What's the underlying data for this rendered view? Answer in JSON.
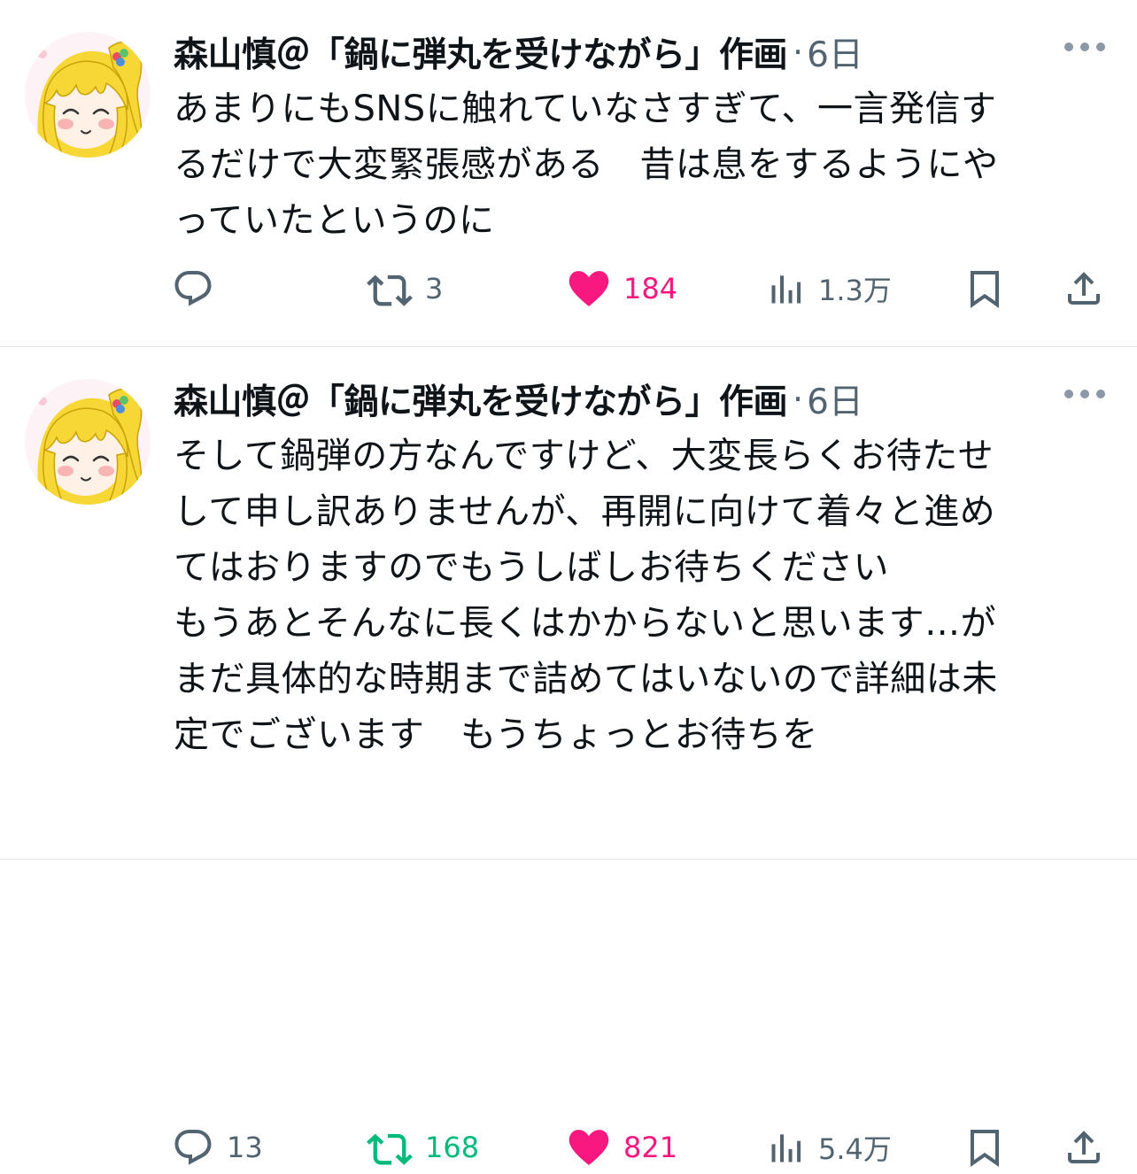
{
  "tweets": [
    {
      "author": "森山慎＠「鍋に弾丸を受けながら」作画",
      "separator": "·",
      "time": "6日",
      "lines": [
        "あまりにもSNSに触れていなさすぎて、一言発信す",
        "るだけで大変緊張感がある　昔は息をするようにや",
        "っていたというのに"
      ],
      "stats": {
        "replies": "",
        "reposts": "3",
        "likes": "184",
        "views": "1.3万"
      },
      "colors": {
        "repost": "#536471",
        "like": "#f91880",
        "like_text": "#f91880"
      }
    },
    {
      "author": "森山慎＠「鍋に弾丸を受けながら」作画",
      "separator": "·",
      "time": "6日",
      "lines": [
        "そして鍋弾の方なんですけど、大変長らくお待たせ",
        "して申し訳ありませんが、再開に向けて着々と進め",
        "てはおりますのでもうしばしお待ちください",
        "もうあとそんなに長くはかからないと思います…が",
        "まだ具体的な時期まで詰めてはいないので詳細は未",
        "定でございます　もうちょっとお待ちを"
      ],
      "stats": {
        "replies": "13",
        "reposts": "168",
        "likes": "821",
        "views": "5.4万"
      },
      "colors": {
        "repost": "#00ba7c",
        "like": "#f91880",
        "like_text": "#f91880"
      }
    }
  ],
  "icons": {
    "reply": "reply-icon",
    "repost": "repost-icon",
    "like": "heart-icon",
    "views": "views-icon",
    "bookmark": "bookmark-icon",
    "share": "share-icon",
    "more": "more-icon"
  },
  "theme": {
    "text": "#0f1419",
    "secondary": "#536471",
    "divider": "#e1e5e8"
  }
}
